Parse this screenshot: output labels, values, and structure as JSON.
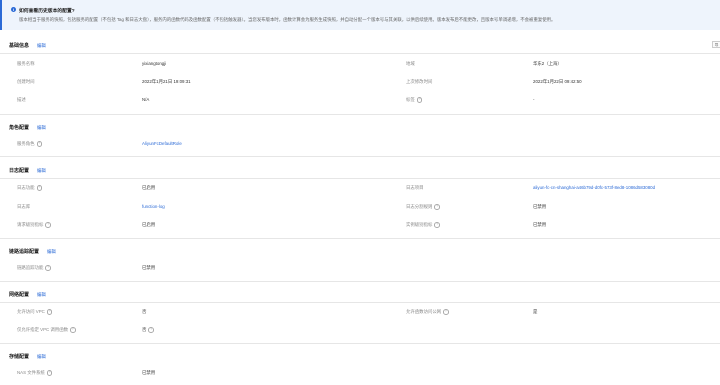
{
  "notice": {
    "title": "如何查看历史版本的配置?",
    "body": "版本相当于服务的快照，包括服务的配置（不包括 Tag 和日志大盘），服务内的函数代码及函数配置（不包括触发器）。当您发布版本时，函数计算会为服务生成快照，并自动分配一个版本号与其关联，以供后续使用。版本发布后不能更改，且版本号单调递增，不会被重复使用。"
  },
  "side_button": "导",
  "sections": {
    "basic": {
      "title": "基础信息",
      "edit": "编辑",
      "service_name_label": "服务名称",
      "service_name": "yixiangtongji",
      "region_label": "地域",
      "region": "华东2（上海）",
      "created_label": "创建时间",
      "created": "2022年1月21日 19:09:31",
      "modified_label": "上次修改时间",
      "modified": "2022年1月22日 09:42:50",
      "desc_label": "描述",
      "desc": "N/A",
      "tags_label": "标签",
      "tags": "-"
    },
    "role": {
      "title": "角色配置",
      "edit": "编辑",
      "role_label": "服务角色",
      "role": "AliyunFcDefaultRole"
    },
    "log": {
      "title": "日志配置",
      "edit": "编辑",
      "log_func_label": "日志功能",
      "log_func": "已启用",
      "project_label": "日志项目",
      "project": "aliyun-fc-cn-shanghai-a46b79d-d0fc-573f-8ed8-1086d583080d",
      "store_label": "日志库",
      "store": "function-log",
      "split_label": "日志分割规则",
      "split": "已禁用",
      "req_metric_label": "请求级别指标",
      "req_metric": "已启用",
      "inst_metric_label": "实例级别指标",
      "inst_metric": "已禁用"
    },
    "trace": {
      "title": "链路追踪配置",
      "edit": "编辑",
      "trace_label": "链路追踪功能",
      "trace": "已禁用"
    },
    "network": {
      "title": "网络配置",
      "edit": "编辑",
      "vpc_label": "允许访问 VPC",
      "vpc": "否",
      "internet_label": "允许函数访问公网",
      "internet": "是",
      "only_vpc_label": "仅允许指定 VPC 调用函数",
      "only_vpc": "否"
    },
    "storage": {
      "title": "存储配置",
      "edit": "编辑",
      "nas_label": "NAS 文件系统",
      "nas": "已禁用"
    }
  },
  "colors": {
    "accent": "#2b6ad6",
    "notice_bg": "#eef4fc"
  }
}
